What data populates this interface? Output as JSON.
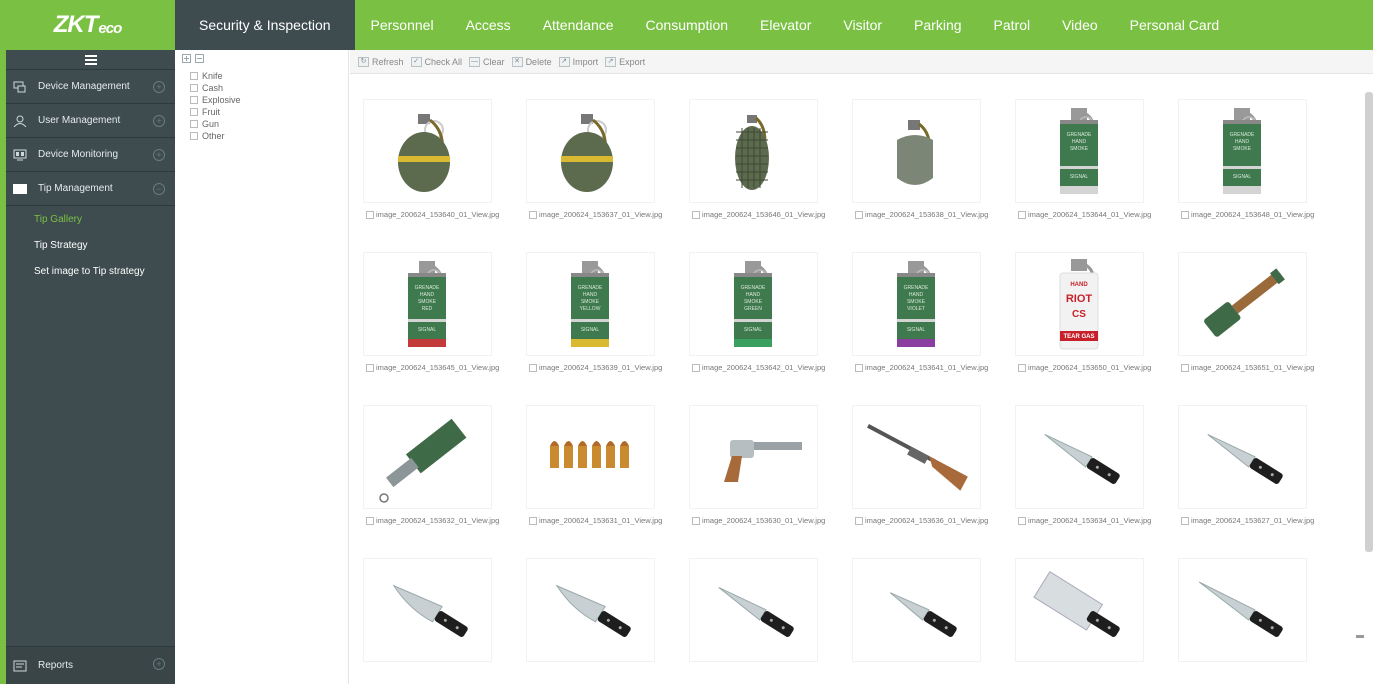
{
  "app": {
    "logo_main": "ZKT",
    "logo_small": "eco"
  },
  "nav": {
    "tabs": [
      "Security & Inspection",
      "Personnel",
      "Access",
      "Attendance",
      "Consumption",
      "Elevator",
      "Visitor",
      "Parking",
      "Patrol",
      "Video",
      "Personal Card"
    ],
    "active": 0
  },
  "sidebar": {
    "top_icon": "menu-icon",
    "menus": [
      {
        "label": "Device Management",
        "icon": "device-icon"
      },
      {
        "label": "User Management",
        "icon": "user-icon"
      },
      {
        "label": "Device Monitoring",
        "icon": "monitor-icon"
      },
      {
        "label": "Tip Management",
        "icon": "tip-icon"
      }
    ],
    "submenu": [
      "Tip Gallery",
      "Tip Strategy",
      "Set image to Tip strategy"
    ],
    "active_submenu": 0,
    "reports": "Reports"
  },
  "tree": {
    "items": [
      "Knife",
      "Cash",
      "Explosive",
      "Fruit",
      "Gun",
      "Other"
    ]
  },
  "toolbar": [
    "Refresh",
    "Check All",
    "Clear",
    "Delete",
    "Import",
    "Export"
  ],
  "images": [
    {
      "name": "image_200624_153640_01_View.jpg",
      "kind": "grenade-ring"
    },
    {
      "name": "image_200624_153637_01_View.jpg",
      "kind": "grenade-ring"
    },
    {
      "name": "image_200624_153646_01_View.jpg",
      "kind": "grenade-pineapple"
    },
    {
      "name": "image_200624_153638_01_View.jpg",
      "kind": "grenade-round"
    },
    {
      "name": "image_200624_153644_01_View.jpg",
      "kind": "smoke-can-green"
    },
    {
      "name": "image_200624_153648_01_View.jpg",
      "kind": "smoke-can-green"
    },
    {
      "name": "image_200624_153645_01_View.jpg",
      "kind": "smoke-red"
    },
    {
      "name": "image_200624_153639_01_View.jpg",
      "kind": "smoke-yellow"
    },
    {
      "name": "image_200624_153642_01_View.jpg",
      "kind": "smoke-green"
    },
    {
      "name": "image_200624_153641_01_View.jpg",
      "kind": "smoke-violet"
    },
    {
      "name": "image_200624_153650_01_View.jpg",
      "kind": "riot-cs"
    },
    {
      "name": "image_200624_153651_01_View.jpg",
      "kind": "stick-grenade"
    },
    {
      "name": "image_200624_153632_01_View.jpg",
      "kind": "flashlight"
    },
    {
      "name": "image_200624_153631_01_View.jpg",
      "kind": "bullets"
    },
    {
      "name": "image_200624_153630_01_View.jpg",
      "kind": "revolver"
    },
    {
      "name": "image_200624_153636_01_View.jpg",
      "kind": "rifle"
    },
    {
      "name": "image_200624_153634_01_View.jpg",
      "kind": "knife"
    },
    {
      "name": "image_200624_153627_01_View.jpg",
      "kind": "knife"
    },
    {
      "name": "",
      "kind": "knife-santoku"
    },
    {
      "name": "",
      "kind": "knife-santoku"
    },
    {
      "name": "",
      "kind": "knife"
    },
    {
      "name": "",
      "kind": "knife-small"
    },
    {
      "name": "",
      "kind": "cleaver"
    },
    {
      "name": "",
      "kind": "knife-long"
    }
  ],
  "grenade_texts": {
    "smoke": [
      "GRENADE",
      "HAND",
      "SMOKE"
    ],
    "signal": "SIGNAL",
    "riot": [
      "HAND",
      "RIOT",
      "CS",
      "TEAR GAS"
    ]
  },
  "smoke_colors": {
    "smoke-red": "RED",
    "smoke-yellow": "YELLOW",
    "smoke-green": "GREEN",
    "smoke-violet": "VIOLET"
  },
  "smoke_band_colors": {
    "smoke-red": "#c23a3a",
    "smoke-yellow": "#d9b832",
    "smoke-green": "#3aa060",
    "smoke-violet": "#8a3ea0"
  },
  "colors": {
    "brand": "#7ac143",
    "sidebar": "#3e4b4f",
    "grenade": "#5c6b4e",
    "can": "#3f7a4f"
  }
}
